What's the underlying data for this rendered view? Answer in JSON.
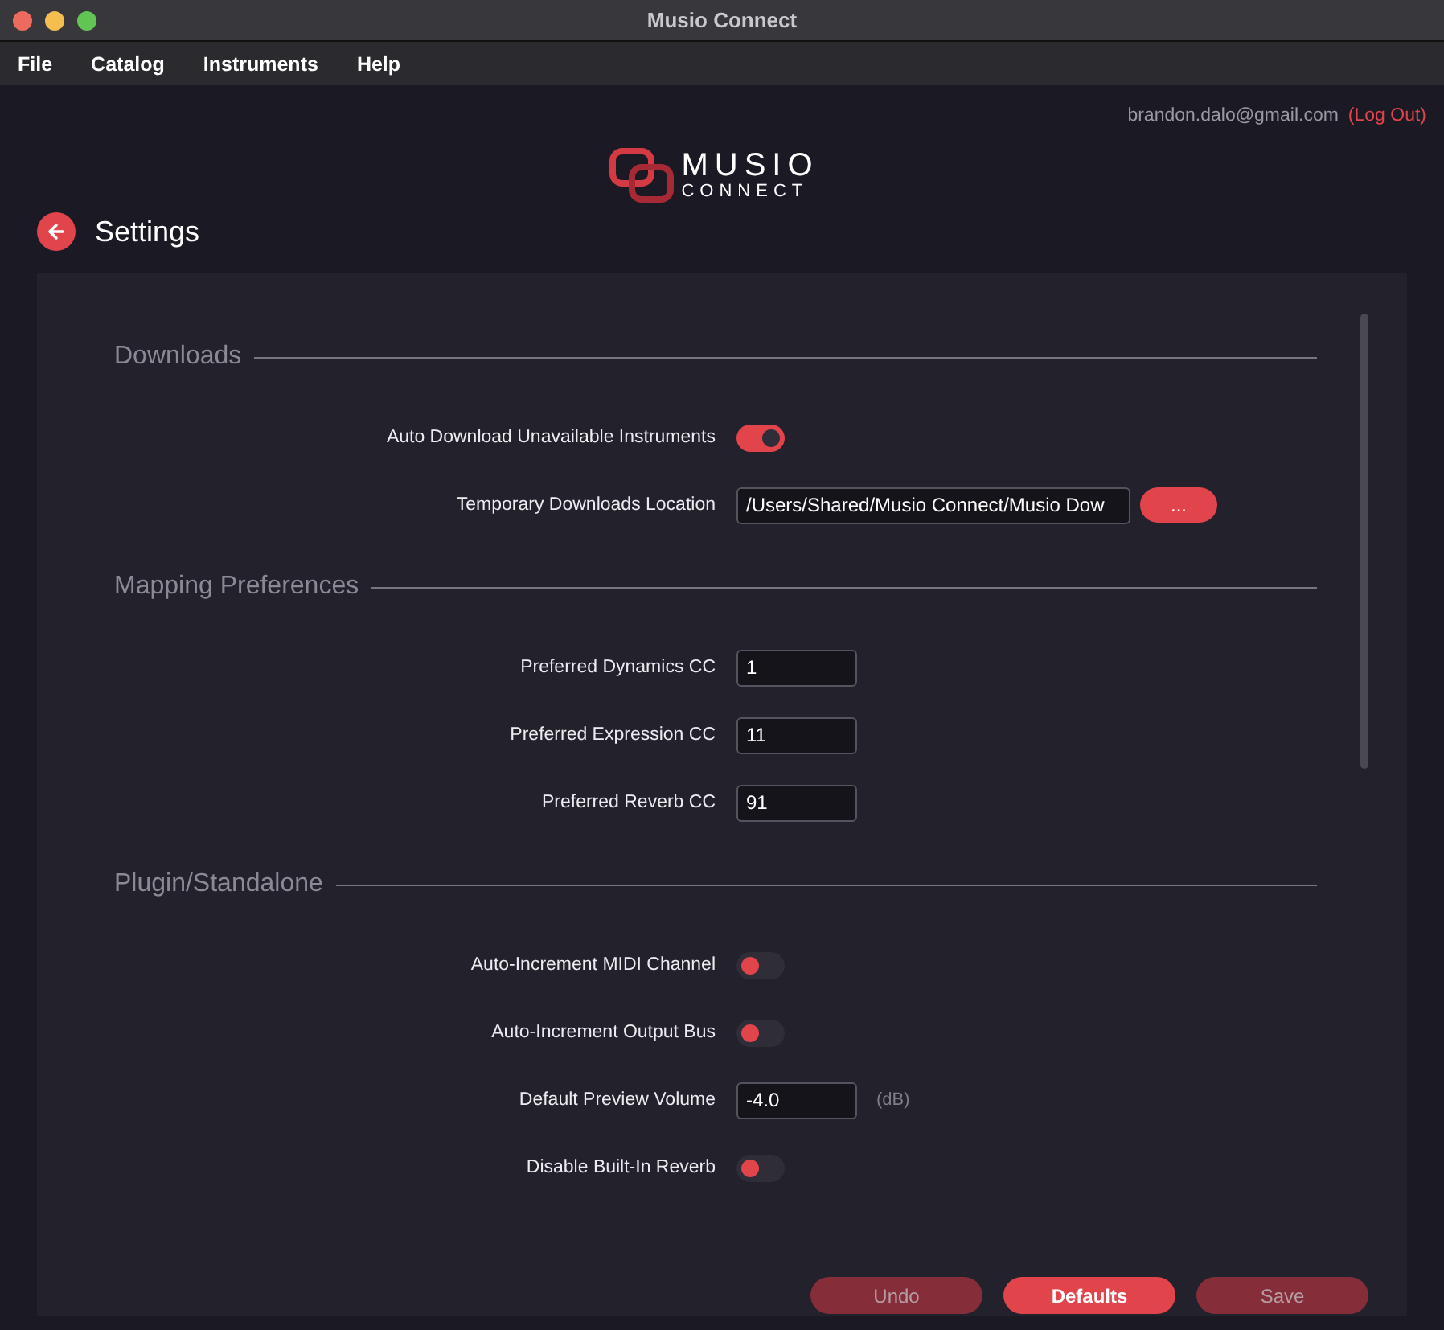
{
  "window": {
    "title": "Musio Connect"
  },
  "menu": [
    "File",
    "Catalog",
    "Instruments",
    "Help"
  ],
  "account": {
    "email": "brandon.dalo@gmail.com",
    "logout": "(Log Out)"
  },
  "logo": {
    "line_1": "MUSIO",
    "line_2": "CONNECT"
  },
  "page_title": "Settings",
  "sections": [
    {
      "title": "Downloads",
      "rows": [
        {
          "kind": "toggle",
          "label": "Auto Download Unavailable Instruments",
          "on": true
        },
        {
          "kind": "path",
          "label": "Temporary Downloads Location",
          "value": "/Users/Shared/Musio Connect/Musio Dow",
          "button": "..."
        }
      ]
    },
    {
      "title": "Mapping Preferences",
      "rows": [
        {
          "kind": "number",
          "label": "Preferred Dynamics CC",
          "value": "1"
        },
        {
          "kind": "number",
          "label": "Preferred Expression CC",
          "value": "11"
        },
        {
          "kind": "number",
          "label": "Preferred Reverb CC",
          "value": "91"
        }
      ]
    },
    {
      "title": "Plugin/Standalone",
      "rows": [
        {
          "kind": "toggle",
          "label": "Auto-Increment MIDI Channel",
          "on": false
        },
        {
          "kind": "toggle",
          "label": "Auto-Increment Output Bus",
          "on": false
        },
        {
          "kind": "number",
          "label": "Default Preview Volume",
          "value": "-4.0",
          "unit": "(dB)"
        },
        {
          "kind": "toggle",
          "label": "Disable Built-In Reverb",
          "on": false
        }
      ]
    }
  ],
  "buttons": [
    {
      "label": "Undo",
      "disabled": true
    },
    {
      "label": "Defaults",
      "disabled": false
    },
    {
      "label": "Save",
      "disabled": true
    }
  ]
}
